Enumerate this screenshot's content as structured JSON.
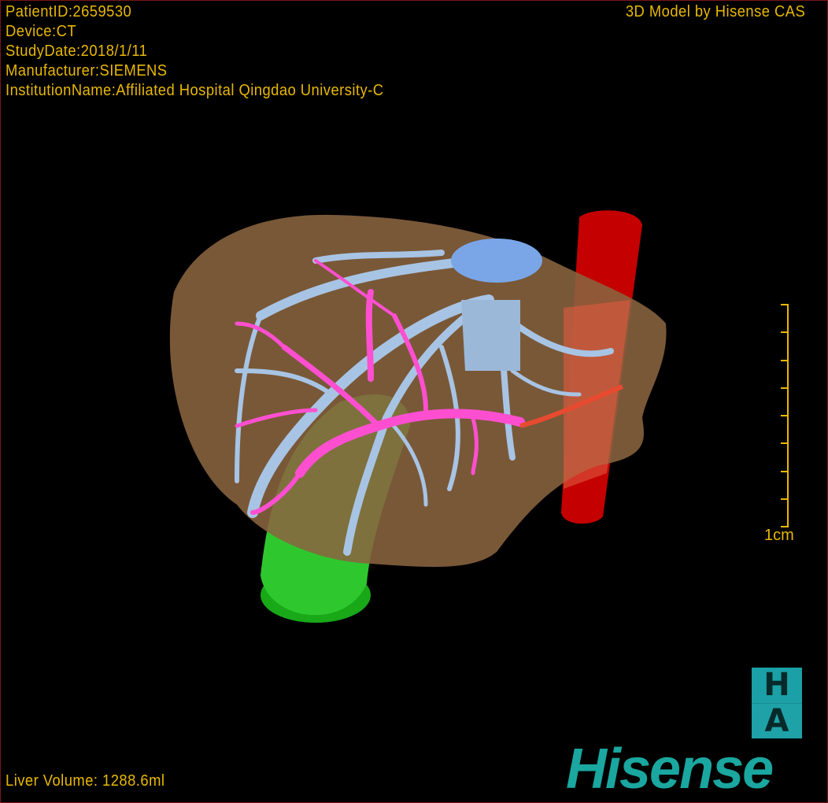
{
  "header": {
    "patient_id": "PatientID:2659530",
    "device": "Device:CT",
    "study_date": "StudyDate:2018/1/11",
    "manufacturer": "Manufacturer:SIEMENS",
    "institution": "InstitutionName:Affiliated Hospital Qingdao University-C",
    "brand_caption": "3D Model by Hisense CAS"
  },
  "footer": {
    "liver_volume": "Liver Volume: 1288.6ml"
  },
  "scale_bar": {
    "label": "1cm",
    "ticks": 9
  },
  "logo": {
    "badge_top": "H",
    "badge_bottom": "A",
    "wordmark": "Hisense"
  },
  "colors": {
    "overlay_text": "#e8b800",
    "liver": "#8a6440",
    "hepatic_vein": "#a8c4e4",
    "portal_vein": "#ff4fd0",
    "ivc": "#c00000",
    "gallbladder": "#22c022",
    "brand": "#1aa7a0",
    "border": "#7a1515"
  }
}
